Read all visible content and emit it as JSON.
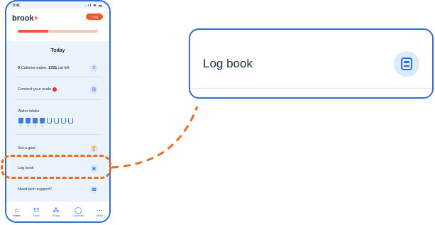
{
  "status": {
    "time": "9:41",
    "icons": "..ıl ≋ ▬"
  },
  "header": {
    "logo_main": "brook",
    "logo_plus": "+",
    "log_button": "+ Log",
    "progress_fraction": 0.38
  },
  "today": {
    "title": "Today",
    "calories": {
      "eaten_value": "0",
      "eaten_suffix": " Calories eaten, ",
      "left_value": "1721",
      "left_suffix": " cal left"
    },
    "connect_scale": "Connect your scale",
    "alert_mark": "!",
    "water": {
      "label": "Water intake",
      "filled": 4,
      "total": 8,
      "numbers": [
        "1",
        "2",
        "3",
        "4"
      ]
    },
    "goal": "Set a goal",
    "logbook": "Log book",
    "support": "Need tech support?"
  },
  "tabbar": [
    {
      "label": "Home",
      "icon": "home-icon"
    },
    {
      "label": "Food",
      "icon": "apple-icon"
    },
    {
      "label": "Group",
      "icon": "group-icon"
    },
    {
      "label": "Coaches",
      "icon": "chat-icon"
    },
    {
      "label": "More",
      "icon": "more-icon"
    }
  ],
  "zoom": {
    "label": "Log book"
  },
  "colors": {
    "accent": "#ef5a2e",
    "primary": "#2f6fd6",
    "highlight": "#f26a1b"
  }
}
